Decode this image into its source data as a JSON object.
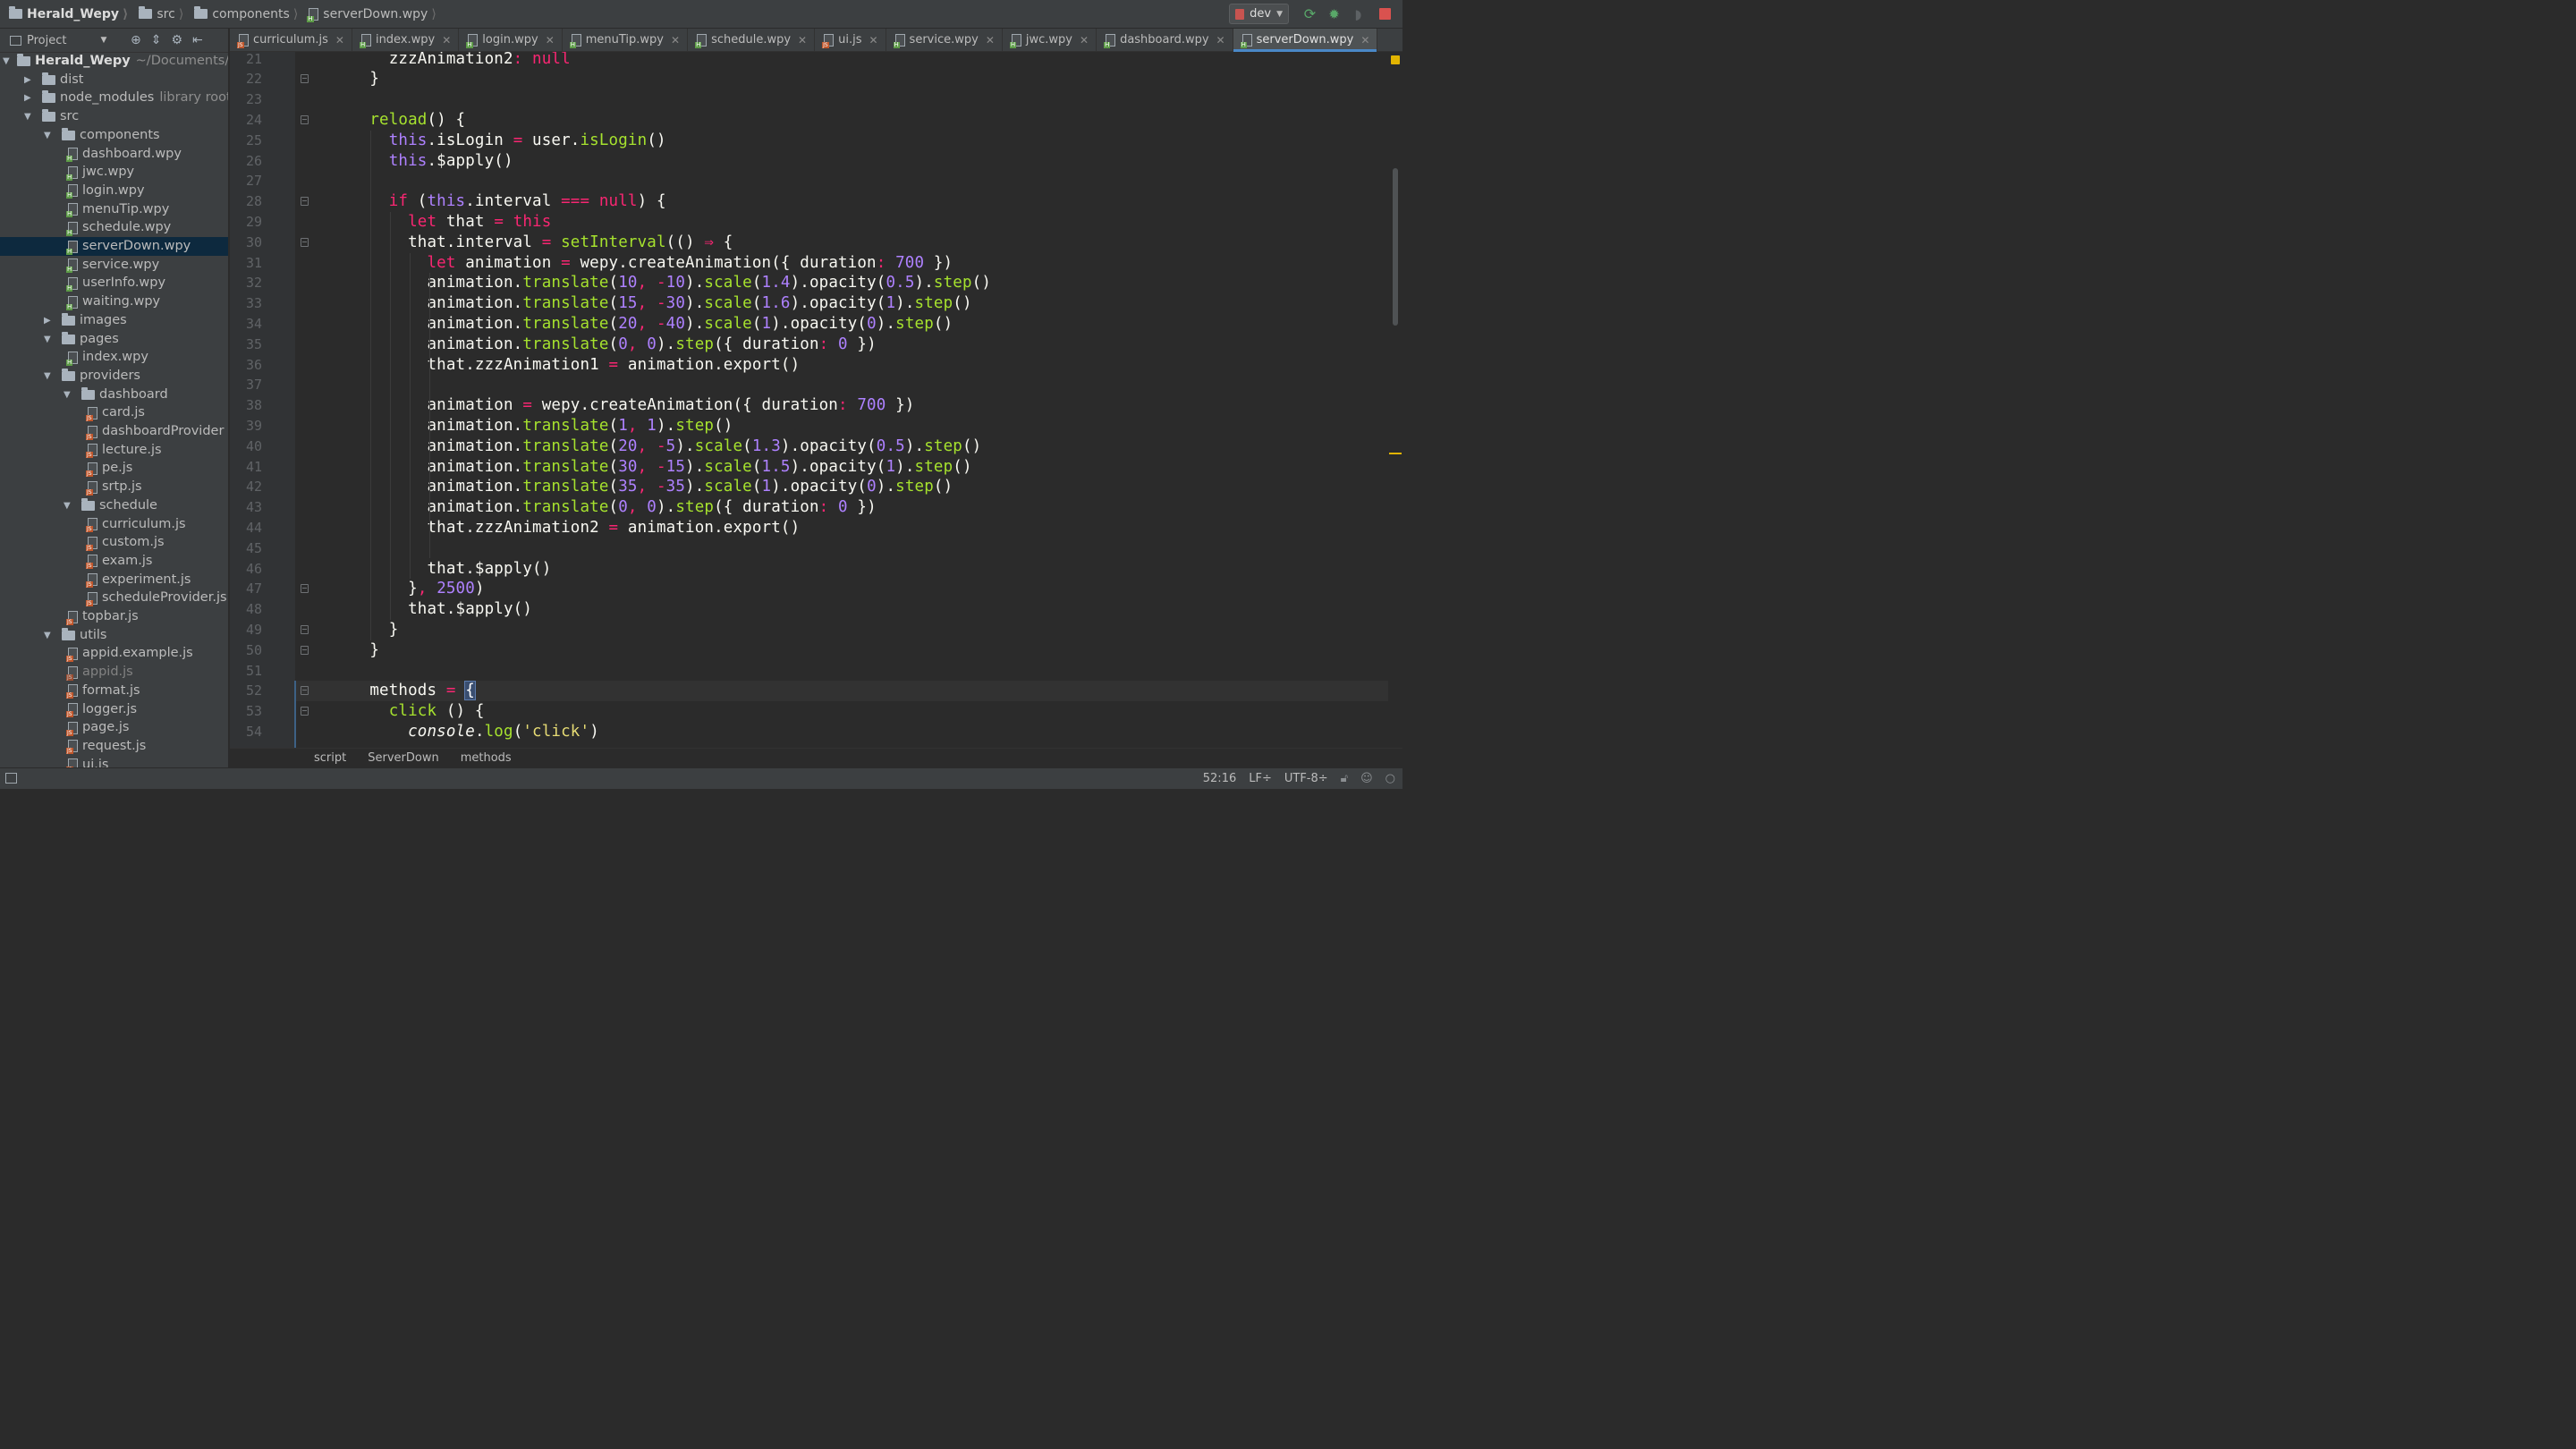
{
  "navbar": {
    "crumbs": [
      {
        "label": "Herald_Wepy",
        "kind": "folder"
      },
      {
        "label": "src",
        "kind": "folder"
      },
      {
        "label": "components",
        "kind": "folder"
      },
      {
        "label": "serverDown.wpy",
        "kind": "wpy"
      }
    ],
    "run_config": "dev"
  },
  "project_panel": {
    "title": "Project",
    "tree": [
      {
        "label": "Herald_Wepy",
        "hint": "~/Documents/He",
        "depth": 0,
        "type": "root",
        "open": true
      },
      {
        "label": "dist",
        "depth": 1,
        "type": "folder",
        "open": false
      },
      {
        "label": "node_modules",
        "hint": "library root",
        "depth": 1,
        "type": "folder",
        "open": false
      },
      {
        "label": "src",
        "depth": 1,
        "type": "folder",
        "open": true
      },
      {
        "label": "components",
        "depth": 2,
        "type": "folder",
        "open": true
      },
      {
        "label": "dashboard.wpy",
        "depth": 3,
        "type": "wpy"
      },
      {
        "label": "jwc.wpy",
        "depth": 3,
        "type": "wpy"
      },
      {
        "label": "login.wpy",
        "depth": 3,
        "type": "wpy"
      },
      {
        "label": "menuTip.wpy",
        "depth": 3,
        "type": "wpy"
      },
      {
        "label": "schedule.wpy",
        "depth": 3,
        "type": "wpy"
      },
      {
        "label": "serverDown.wpy",
        "depth": 3,
        "type": "wpy",
        "selected": true
      },
      {
        "label": "service.wpy",
        "depth": 3,
        "type": "wpy"
      },
      {
        "label": "userInfo.wpy",
        "depth": 3,
        "type": "wpy"
      },
      {
        "label": "waiting.wpy",
        "depth": 3,
        "type": "wpy"
      },
      {
        "label": "images",
        "depth": 2,
        "type": "folder",
        "open": false
      },
      {
        "label": "pages",
        "depth": 2,
        "type": "folder",
        "open": true
      },
      {
        "label": "index.wpy",
        "depth": 3,
        "type": "wpy"
      },
      {
        "label": "providers",
        "depth": 2,
        "type": "folder",
        "open": true
      },
      {
        "label": "dashboard",
        "depth": 3,
        "type": "folder",
        "open": true
      },
      {
        "label": "card.js",
        "depth": 4,
        "type": "js"
      },
      {
        "label": "dashboardProvider",
        "depth": 4,
        "type": "js"
      },
      {
        "label": "lecture.js",
        "depth": 4,
        "type": "js"
      },
      {
        "label": "pe.js",
        "depth": 4,
        "type": "js"
      },
      {
        "label": "srtp.js",
        "depth": 4,
        "type": "js"
      },
      {
        "label": "schedule",
        "depth": 3,
        "type": "folder",
        "open": true
      },
      {
        "label": "curriculum.js",
        "depth": 4,
        "type": "js"
      },
      {
        "label": "custom.js",
        "depth": 4,
        "type": "js"
      },
      {
        "label": "exam.js",
        "depth": 4,
        "type": "js"
      },
      {
        "label": "experiment.js",
        "depth": 4,
        "type": "js"
      },
      {
        "label": "scheduleProvider.js",
        "depth": 4,
        "type": "js"
      },
      {
        "label": "topbar.js",
        "depth": 3,
        "type": "js"
      },
      {
        "label": "utils",
        "depth": 2,
        "type": "folder",
        "open": true
      },
      {
        "label": "appid.example.js",
        "depth": 3,
        "type": "js"
      },
      {
        "label": "appid.js",
        "depth": 3,
        "type": "js",
        "dim": true
      },
      {
        "label": "format.js",
        "depth": 3,
        "type": "js"
      },
      {
        "label": "logger.js",
        "depth": 3,
        "type": "js"
      },
      {
        "label": "page.js",
        "depth": 3,
        "type": "js"
      },
      {
        "label": "request.js",
        "depth": 3,
        "type": "js"
      },
      {
        "label": "ui.js",
        "depth": 3,
        "type": "js"
      }
    ]
  },
  "tabs": [
    {
      "label": "curriculum.js",
      "type": "js"
    },
    {
      "label": "index.wpy",
      "type": "wpy"
    },
    {
      "label": "login.wpy",
      "type": "wpy"
    },
    {
      "label": "menuTip.wpy",
      "type": "wpy"
    },
    {
      "label": "schedule.wpy",
      "type": "wpy"
    },
    {
      "label": "ui.js",
      "type": "js"
    },
    {
      "label": "service.wpy",
      "type": "wpy"
    },
    {
      "label": "jwc.wpy",
      "type": "wpy"
    },
    {
      "label": "dashboard.wpy",
      "type": "wpy"
    },
    {
      "label": "serverDown.wpy",
      "type": "wpy",
      "active": true
    }
  ],
  "editor": {
    "first_line": 21,
    "current_line": 52,
    "lines": [
      [
        [
          "c-white",
          "    zzzAnimation2"
        ],
        [
          "c-pink",
          ":"
        ],
        [
          "c-white",
          " "
        ],
        [
          "c-pink",
          "null"
        ]
      ],
      [
        [
          "c-white",
          "  }"
        ]
      ],
      [],
      [
        [
          "c-white",
          "  "
        ],
        [
          "c-green",
          "reload"
        ],
        [
          "c-white",
          "() {"
        ]
      ],
      [
        [
          "c-white",
          "    "
        ],
        [
          "c-purple",
          "this"
        ],
        [
          "c-white",
          ".isLogin "
        ],
        [
          "c-pink",
          "="
        ],
        [
          "c-white",
          " user."
        ],
        [
          "c-green",
          "isLogin"
        ],
        [
          "c-white",
          "()"
        ]
      ],
      [
        [
          "c-white",
          "    "
        ],
        [
          "c-purple",
          "this"
        ],
        [
          "c-white",
          ".$apply()"
        ]
      ],
      [],
      [
        [
          "c-white",
          "    "
        ],
        [
          "c-pink",
          "if"
        ],
        [
          "c-white",
          " ("
        ],
        [
          "c-purple",
          "this"
        ],
        [
          "c-white",
          ".interval "
        ],
        [
          "c-pink",
          "==="
        ],
        [
          "c-white",
          " "
        ],
        [
          "c-pink",
          "null"
        ],
        [
          "c-white",
          ") {"
        ]
      ],
      [
        [
          "c-white",
          "      "
        ],
        [
          "c-pink",
          "let"
        ],
        [
          "c-white",
          " that "
        ],
        [
          "c-pink",
          "="
        ],
        [
          "c-white",
          " "
        ],
        [
          "c-pink",
          "this"
        ]
      ],
      [
        [
          "c-white",
          "      that.interval "
        ],
        [
          "c-pink",
          "="
        ],
        [
          "c-white",
          " "
        ],
        [
          "c-green",
          "setInterval"
        ],
        [
          "c-white",
          "(() "
        ],
        [
          "c-pink",
          "⇒"
        ],
        [
          "c-white",
          " {"
        ]
      ],
      [
        [
          "c-white",
          "        "
        ],
        [
          "c-pink",
          "let"
        ],
        [
          "c-white",
          " animation "
        ],
        [
          "c-pink",
          "="
        ],
        [
          "c-white",
          " wepy.createAnimation({ duration"
        ],
        [
          "c-pink",
          ":"
        ],
        [
          "c-white",
          " "
        ],
        [
          "c-purple",
          "700"
        ],
        [
          "c-white",
          " })"
        ]
      ],
      [
        [
          "c-white",
          "        animation."
        ],
        [
          "c-green",
          "translate"
        ],
        [
          "c-white",
          "("
        ],
        [
          "c-purple",
          "10"
        ],
        [
          "c-pink",
          ","
        ],
        [
          "c-white",
          " "
        ],
        [
          "c-pink",
          "-"
        ],
        [
          "c-purple",
          "10"
        ],
        [
          "c-white",
          ")."
        ],
        [
          "c-green",
          "scale"
        ],
        [
          "c-white",
          "("
        ],
        [
          "c-purple",
          "1.4"
        ],
        [
          "c-white",
          ").opacity("
        ],
        [
          "c-purple",
          "0.5"
        ],
        [
          "c-white",
          ")."
        ],
        [
          "c-green",
          "step"
        ],
        [
          "c-white",
          "()"
        ]
      ],
      [
        [
          "c-white",
          "        animation."
        ],
        [
          "c-green",
          "translate"
        ],
        [
          "c-white",
          "("
        ],
        [
          "c-purple",
          "15"
        ],
        [
          "c-pink",
          ","
        ],
        [
          "c-white",
          " "
        ],
        [
          "c-pink",
          "-"
        ],
        [
          "c-purple",
          "30"
        ],
        [
          "c-white",
          ")."
        ],
        [
          "c-green",
          "scale"
        ],
        [
          "c-white",
          "("
        ],
        [
          "c-purple",
          "1.6"
        ],
        [
          "c-white",
          ").opacity("
        ],
        [
          "c-purple",
          "1"
        ],
        [
          "c-white",
          ")."
        ],
        [
          "c-green",
          "step"
        ],
        [
          "c-white",
          "()"
        ]
      ],
      [
        [
          "c-white",
          "        animation."
        ],
        [
          "c-green",
          "translate"
        ],
        [
          "c-white",
          "("
        ],
        [
          "c-purple",
          "20"
        ],
        [
          "c-pink",
          ","
        ],
        [
          "c-white",
          " "
        ],
        [
          "c-pink",
          "-"
        ],
        [
          "c-purple",
          "40"
        ],
        [
          "c-white",
          ")."
        ],
        [
          "c-green",
          "scale"
        ],
        [
          "c-white",
          "("
        ],
        [
          "c-purple",
          "1"
        ],
        [
          "c-white",
          ").opacity("
        ],
        [
          "c-purple",
          "0"
        ],
        [
          "c-white",
          ")."
        ],
        [
          "c-green",
          "step"
        ],
        [
          "c-white",
          "()"
        ]
      ],
      [
        [
          "c-white",
          "        animation."
        ],
        [
          "c-green",
          "translate"
        ],
        [
          "c-white",
          "("
        ],
        [
          "c-purple",
          "0"
        ],
        [
          "c-pink",
          ","
        ],
        [
          "c-white",
          " "
        ],
        [
          "c-purple",
          "0"
        ],
        [
          "c-white",
          ")."
        ],
        [
          "c-green",
          "step"
        ],
        [
          "c-white",
          "({ duration"
        ],
        [
          "c-pink",
          ":"
        ],
        [
          "c-white",
          " "
        ],
        [
          "c-purple",
          "0"
        ],
        [
          "c-white",
          " })"
        ]
      ],
      [
        [
          "c-white",
          "        that.zzzAnimation1 "
        ],
        [
          "c-pink",
          "="
        ],
        [
          "c-white",
          " animation.export()"
        ]
      ],
      [],
      [
        [
          "c-white",
          "        animation "
        ],
        [
          "c-pink",
          "="
        ],
        [
          "c-white",
          " wepy.createAnimation({ duration"
        ],
        [
          "c-pink",
          ":"
        ],
        [
          "c-white",
          " "
        ],
        [
          "c-purple",
          "700"
        ],
        [
          "c-white",
          " })"
        ]
      ],
      [
        [
          "c-white",
          "        animation."
        ],
        [
          "c-green",
          "translate"
        ],
        [
          "c-white",
          "("
        ],
        [
          "c-purple",
          "1"
        ],
        [
          "c-pink",
          ","
        ],
        [
          "c-white",
          " "
        ],
        [
          "c-purple",
          "1"
        ],
        [
          "c-white",
          ")."
        ],
        [
          "c-green",
          "step"
        ],
        [
          "c-white",
          "()"
        ]
      ],
      [
        [
          "c-white",
          "        animation."
        ],
        [
          "c-green",
          "translate"
        ],
        [
          "c-white",
          "("
        ],
        [
          "c-purple",
          "20"
        ],
        [
          "c-pink",
          ","
        ],
        [
          "c-white",
          " "
        ],
        [
          "c-pink",
          "-"
        ],
        [
          "c-purple",
          "5"
        ],
        [
          "c-white",
          ")."
        ],
        [
          "c-green",
          "scale"
        ],
        [
          "c-white",
          "("
        ],
        [
          "c-purple",
          "1.3"
        ],
        [
          "c-white",
          ").opacity("
        ],
        [
          "c-purple",
          "0.5"
        ],
        [
          "c-white",
          ")."
        ],
        [
          "c-green",
          "step"
        ],
        [
          "c-white",
          "()"
        ]
      ],
      [
        [
          "c-white",
          "        animation."
        ],
        [
          "c-green",
          "translate"
        ],
        [
          "c-white",
          "("
        ],
        [
          "c-purple",
          "30"
        ],
        [
          "c-pink",
          ","
        ],
        [
          "c-white",
          " "
        ],
        [
          "c-pink",
          "-"
        ],
        [
          "c-purple",
          "15"
        ],
        [
          "c-white",
          ")."
        ],
        [
          "c-green",
          "scale"
        ],
        [
          "c-white",
          "("
        ],
        [
          "c-purple",
          "1.5"
        ],
        [
          "c-white",
          ").opacity("
        ],
        [
          "c-purple",
          "1"
        ],
        [
          "c-white",
          ")."
        ],
        [
          "c-green",
          "step"
        ],
        [
          "c-white",
          "()"
        ]
      ],
      [
        [
          "c-white",
          "        animation."
        ],
        [
          "c-green",
          "translate"
        ],
        [
          "c-white",
          "("
        ],
        [
          "c-purple",
          "35"
        ],
        [
          "c-pink",
          ","
        ],
        [
          "c-white",
          " "
        ],
        [
          "c-pink",
          "-"
        ],
        [
          "c-purple",
          "35"
        ],
        [
          "c-white",
          ")."
        ],
        [
          "c-green",
          "scale"
        ],
        [
          "c-white",
          "("
        ],
        [
          "c-purple",
          "1"
        ],
        [
          "c-white",
          ").opacity("
        ],
        [
          "c-purple",
          "0"
        ],
        [
          "c-white",
          ")."
        ],
        [
          "c-green",
          "step"
        ],
        [
          "c-white",
          "()"
        ]
      ],
      [
        [
          "c-white",
          "        animation."
        ],
        [
          "c-green",
          "translate"
        ],
        [
          "c-white",
          "("
        ],
        [
          "c-purple",
          "0"
        ],
        [
          "c-pink",
          ","
        ],
        [
          "c-white",
          " "
        ],
        [
          "c-purple",
          "0"
        ],
        [
          "c-white",
          ")."
        ],
        [
          "c-green",
          "step"
        ],
        [
          "c-white",
          "({ duration"
        ],
        [
          "c-pink",
          ":"
        ],
        [
          "c-white",
          " "
        ],
        [
          "c-purple",
          "0"
        ],
        [
          "c-white",
          " })"
        ]
      ],
      [
        [
          "c-white",
          "        that.zzzAnimation2 "
        ],
        [
          "c-pink",
          "="
        ],
        [
          "c-white",
          " animation.export()"
        ]
      ],
      [],
      [
        [
          "c-white",
          "        that.$apply()"
        ]
      ],
      [
        [
          "c-white",
          "      }"
        ],
        [
          "c-pink",
          ","
        ],
        [
          "c-white",
          " "
        ],
        [
          "c-purple",
          "2500"
        ],
        [
          "c-white",
          ")"
        ]
      ],
      [
        [
          "c-white",
          "      that.$apply()"
        ]
      ],
      [
        [
          "c-white",
          "    }"
        ]
      ],
      [
        [
          "c-white",
          "  }"
        ]
      ],
      [],
      [
        [
          "c-white",
          "  methods "
        ],
        [
          "c-pink",
          "="
        ],
        [
          "c-white",
          " "
        ],
        [
          "bracehl",
          "{"
        ]
      ],
      [
        [
          "c-white",
          "    "
        ],
        [
          "c-green",
          "click"
        ],
        [
          "c-white",
          " () {"
        ]
      ],
      [
        [
          "c-white",
          "      "
        ],
        [
          "c-italic",
          "console"
        ],
        [
          "c-white",
          "."
        ],
        [
          "c-green",
          "log"
        ],
        [
          "c-white",
          "("
        ],
        [
          "c-yellow",
          "'click'"
        ],
        [
          "c-white",
          ")"
        ]
      ]
    ]
  },
  "breadcrumb_bar": [
    "script",
    "ServerDown",
    "methods"
  ],
  "statusbar": {
    "position": "52:16",
    "line_sep": "LF÷",
    "encoding": "UTF-8÷"
  }
}
